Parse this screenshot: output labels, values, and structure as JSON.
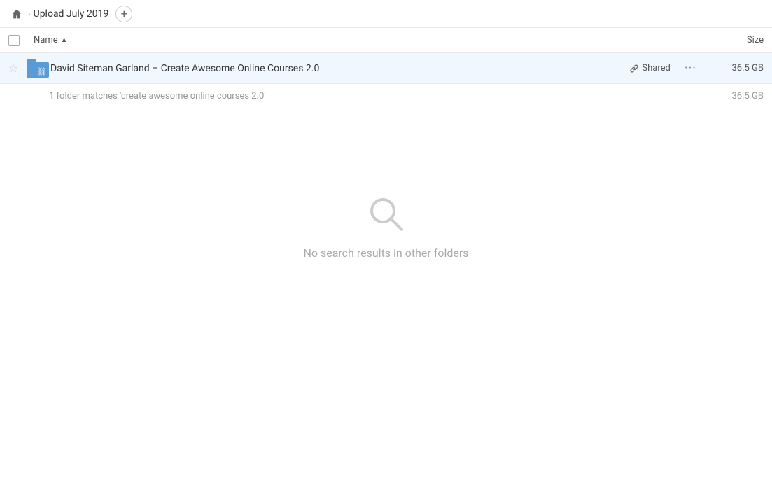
{
  "breadcrumb": {
    "home_icon": "home",
    "separator": ">",
    "path_label": "Upload July 2019",
    "add_icon": "+"
  },
  "columns": {
    "name_label": "Name",
    "size_label": "Size"
  },
  "file_row": {
    "name": "David Siteman Garland – Create Awesome Online Courses 2.0",
    "shared_label": "Shared",
    "size": "36.5 GB",
    "more_options": "···"
  },
  "match_info": {
    "text": "1 folder matches 'create awesome online courses 2.0'",
    "size": "36.5 GB"
  },
  "empty_state": {
    "message": "No search results in other folders"
  }
}
